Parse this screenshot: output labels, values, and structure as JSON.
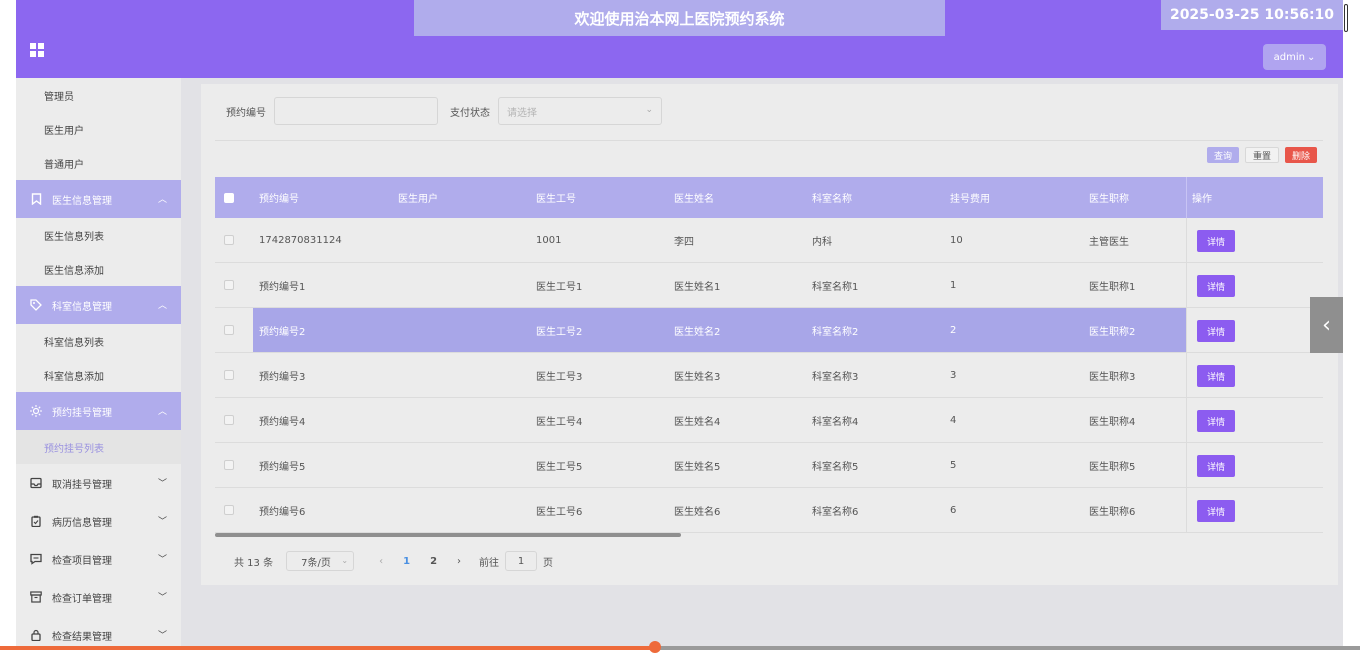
{
  "header": {
    "title": "欢迎使用治本网上医院预约系统",
    "clock": "2025-03-25 10:56:10",
    "user_label": "admin"
  },
  "sidebar": {
    "items": [
      {
        "type": "sub",
        "label": "管理员"
      },
      {
        "type": "sub",
        "label": "医生用户"
      },
      {
        "type": "sub",
        "label": "普通用户"
      },
      {
        "type": "group",
        "label": "医生信息管理",
        "icon": "bookmark-icon",
        "open": true
      },
      {
        "type": "sub",
        "label": "医生信息列表"
      },
      {
        "type": "sub",
        "label": "医生信息添加"
      },
      {
        "type": "group",
        "label": "科室信息管理",
        "icon": "tag-icon",
        "open": true
      },
      {
        "type": "sub",
        "label": "科室信息列表"
      },
      {
        "type": "sub",
        "label": "科室信息添加"
      },
      {
        "type": "group",
        "label": "预约挂号管理",
        "icon": "sun-icon",
        "open": true
      },
      {
        "type": "sub",
        "label": "预约挂号列表",
        "active": true
      },
      {
        "type": "group",
        "label": "取消挂号管理",
        "icon": "inbox-icon",
        "open": false
      },
      {
        "type": "group",
        "label": "病历信息管理",
        "icon": "clipboard-icon",
        "open": false
      },
      {
        "type": "group",
        "label": "检查项目管理",
        "icon": "message-icon",
        "open": false
      },
      {
        "type": "group",
        "label": "检查订单管理",
        "icon": "archive-icon",
        "open": false
      },
      {
        "type": "group",
        "label": "检查结果管理",
        "icon": "lock-icon",
        "open": false
      }
    ]
  },
  "search": {
    "booking_no_label": "预约编号",
    "booking_no_value": "",
    "pay_status_label": "支付状态",
    "pay_status_placeholder": "请选择"
  },
  "actions": {
    "query": "查询",
    "reset": "重置",
    "delete": "删除"
  },
  "table": {
    "columns": [
      "预约编号",
      "医生用户",
      "医生工号",
      "医生姓名",
      "科室名称",
      "挂号费用",
      "医生职称",
      "操作"
    ],
    "rows": [
      {
        "booking_no": "1742870831124",
        "doctor_user": "",
        "doctor_id": "1001",
        "doctor_name": "李四",
        "dept": "内科",
        "fee": "10",
        "title": "主管医生",
        "action": "详情"
      },
      {
        "booking_no": "预约编号1",
        "doctor_user": "",
        "doctor_id": "医生工号1",
        "doctor_name": "医生姓名1",
        "dept": "科室名称1",
        "fee": "1",
        "title": "医生职称1",
        "action": "详情"
      },
      {
        "booking_no": "预约编号2",
        "doctor_user": "",
        "doctor_id": "医生工号2",
        "doctor_name": "医生姓名2",
        "dept": "科室名称2",
        "fee": "2",
        "title": "医生职称2",
        "action": "详情"
      },
      {
        "booking_no": "预约编号3",
        "doctor_user": "",
        "doctor_id": "医生工号3",
        "doctor_name": "医生姓名3",
        "dept": "科室名称3",
        "fee": "3",
        "title": "医生职称3",
        "action": "详情"
      },
      {
        "booking_no": "预约编号4",
        "doctor_user": "",
        "doctor_id": "医生工号4",
        "doctor_name": "医生姓名4",
        "dept": "科室名称4",
        "fee": "4",
        "title": "医生职称4",
        "action": "详情"
      },
      {
        "booking_no": "预约编号5",
        "doctor_user": "",
        "doctor_id": "医生工号5",
        "doctor_name": "医生姓名5",
        "dept": "科室名称5",
        "fee": "5",
        "title": "医生职称5",
        "action": "详情"
      },
      {
        "booking_no": "预约编号6",
        "doctor_user": "",
        "doctor_id": "医生工号6",
        "doctor_name": "医生姓名6",
        "dept": "科室名称6",
        "fee": "6",
        "title": "医生职称6",
        "action": "详情"
      }
    ]
  },
  "pager": {
    "total": "共 13 条",
    "page_size": "7条/页",
    "pages": [
      "1",
      "2"
    ],
    "current": "1",
    "goto_label": "前往",
    "goto_value": "1",
    "page_suffix": "页"
  },
  "colors": {
    "primary": "#8c67f0",
    "light_primary": "#b0acec",
    "danger": "#e8564a",
    "action_button": "#8c5cf0"
  }
}
